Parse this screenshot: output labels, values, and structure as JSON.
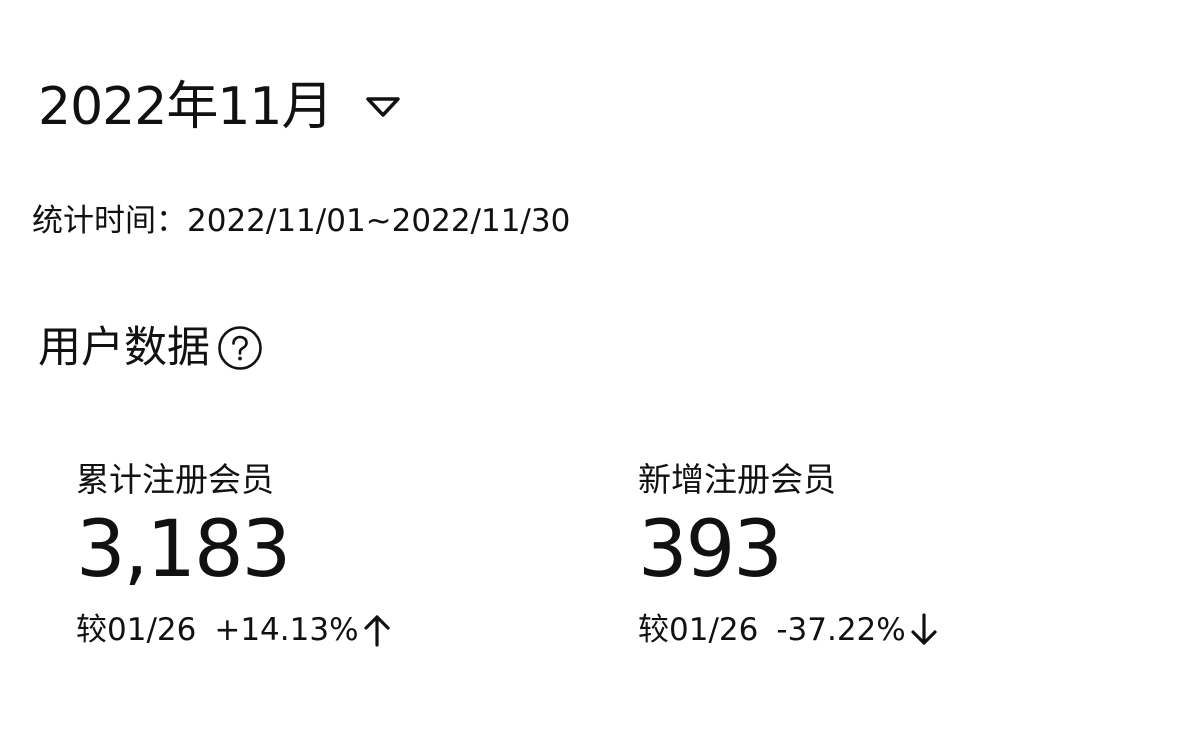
{
  "header": {
    "month_label": "2022年11月",
    "period_text": "统计时间：2022/11/01~2022/11/30"
  },
  "section": {
    "title": "用户数据"
  },
  "metrics": [
    {
      "label": "累计注册会员",
      "value": "3,183",
      "compare_date": "较01/26",
      "change": "+14.13%",
      "trend_icon": "arrow-up-icon"
    },
    {
      "label": "新增注册会员",
      "value": "393",
      "compare_date": "较01/26",
      "change": "-37.22%",
      "trend_icon": "arrow-down-icon"
    }
  ],
  "colors": {
    "text": "#111111",
    "background": "#ffffff"
  }
}
